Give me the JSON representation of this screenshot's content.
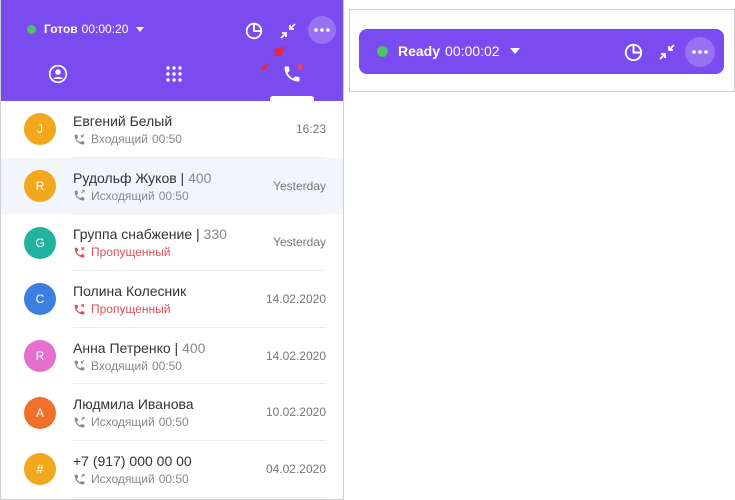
{
  "left": {
    "status": {
      "label": "Готов",
      "timer": "00:00:20",
      "color": "#4cc26a"
    },
    "header_color": "#7a4cf0",
    "tabs": [
      "contacts-icon",
      "dialpad-icon",
      "phone-icon"
    ],
    "calls": [
      {
        "avatar": "J",
        "avatar_color": "#f2a81d",
        "name": "Евгений Белый",
        "ext": "",
        "kind": "Входящий",
        "duration": "00:50",
        "type": "incoming",
        "time": "16:23"
      },
      {
        "avatar": "R",
        "avatar_color": "#f2a81d",
        "name": "Рудольф Жуков | ",
        "ext": "400",
        "kind": "Исходящий",
        "duration": "00:50",
        "type": "outgoing",
        "time": "Yesterday"
      },
      {
        "avatar": "G",
        "avatar_color": "#22b3a0",
        "name": "Группа снабжение | ",
        "ext": "330",
        "kind": "Пропущенный",
        "duration": "",
        "type": "missed",
        "time": "Yesterday"
      },
      {
        "avatar": "C",
        "avatar_color": "#3d7fe0",
        "name": "Полина Колесник",
        "ext": "",
        "kind": "Пропущенный",
        "duration": "",
        "type": "missed",
        "time": "14.02.2020"
      },
      {
        "avatar": "R",
        "avatar_color": "#e56fcf",
        "name": "Анна Петренко | ",
        "ext": "400",
        "kind": "Входящий",
        "duration": "00:50",
        "type": "incoming",
        "time": "14.02.2020"
      },
      {
        "avatar": "A",
        "avatar_color": "#f0702a",
        "name": "Людмила Иванова",
        "ext": "",
        "kind": "Исходящий",
        "duration": "00:50",
        "type": "outgoing",
        "time": "10.02.2020"
      },
      {
        "avatar": "#",
        "avatar_color": "#f2a81d",
        "name": "+7 (917) 000 00 00",
        "ext": "",
        "kind": "Исходящий",
        "duration": "00:50",
        "type": "outgoing",
        "time": "04.02.2020"
      }
    ]
  },
  "right": {
    "status": {
      "label": "Ready",
      "timer": "00:00:02",
      "color": "#4cc26a"
    }
  },
  "icons": {
    "stats": "pie-chart-icon",
    "minimize": "minimize-icon",
    "more": "more-icon"
  }
}
